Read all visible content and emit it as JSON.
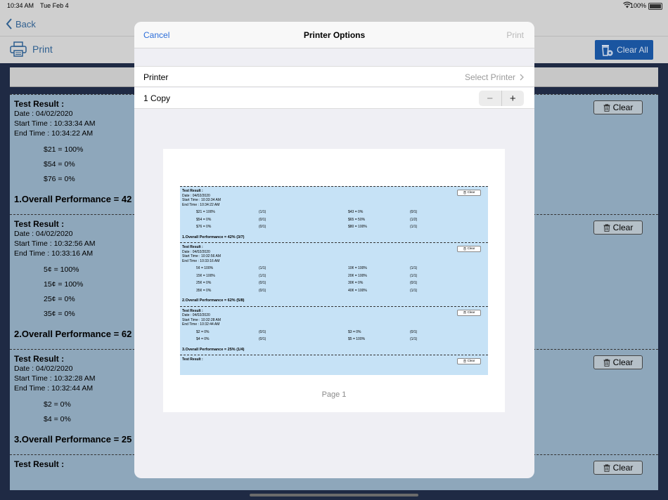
{
  "status_bar": {
    "time": "10:34 AM",
    "date": "Tue Feb 4",
    "battery": "100%",
    "battery_level": 1.0
  },
  "nav": {
    "back_label": "Back"
  },
  "toolbar": {
    "print_label": "Print",
    "clear_all_label": "Clear All"
  },
  "clear_label": "Clear",
  "results": [
    {
      "title": "Test Result :",
      "date": "Date : 04/02/2020",
      "start": "Start Time : 10:33:34 AM",
      "end": "End Time   : 10:34:22 AM",
      "values": [
        "$21 = 100%",
        "$54 = 0%",
        "$76 = 0%"
      ],
      "overall": "1.Overall Performance = 42"
    },
    {
      "title": "Test Result :",
      "date": "Date : 04/02/2020",
      "start": "Start Time : 10:32:56 AM",
      "end": "End Time   : 10:33:16 AM",
      "values": [
        "5¢ = 100%",
        "15¢ = 100%",
        "25¢ = 0%",
        "35¢ = 0%"
      ],
      "overall": "2.Overall Performance = 62"
    },
    {
      "title": "Test Result :",
      "date": "Date : 04/02/2020",
      "start": "Start Time : 10:32:28 AM",
      "end": "End Time   : 10:32:44 AM",
      "values": [
        "$2 = 0%",
        "$4 = 0%"
      ],
      "overall": "3.Overall Performance = 25"
    },
    {
      "title": "Test Result :",
      "date": "",
      "start": "",
      "end": "",
      "values": [],
      "overall": ""
    }
  ],
  "modal": {
    "cancel": "Cancel",
    "title": "Printer Options",
    "print": "Print",
    "printer_label": "Printer",
    "printer_value": "Select Printer",
    "copies_label": "1 Copy",
    "minus": "−",
    "plus": "+",
    "page_label": "Page 1"
  },
  "preview": [
    {
      "title": "Test Result :",
      "date": "Date : 04/02/2020",
      "start": "Start Time : 10:33:34 AM",
      "end": "End Time   : 10:34:22 AM",
      "rows": [
        [
          "$21 = 100%",
          "(1/1)",
          "$43 = 0%",
          "(0/1)"
        ],
        [
          "$54 = 0%",
          "(0/1)",
          "$65 = 50%",
          "(1/2)"
        ],
        [
          "$76 = 0%",
          "(0/1)",
          "$80 = 100%",
          "(1/1)"
        ]
      ],
      "overall": "1.Overall Performance = 42% (3/7)"
    },
    {
      "title": "Test Result :",
      "date": "Date : 04/02/2020",
      "start": "Start Time : 10:32:56 AM",
      "end": "End Time   : 10:33:16 AM",
      "rows": [
        [
          "5¢ = 100%",
          "(1/1)",
          "10¢ = 100%",
          "(1/1)"
        ],
        [
          "15¢ = 100%",
          "(1/1)",
          "20¢ = 100%",
          "(1/1)"
        ],
        [
          "25¢ = 0%",
          "(0/1)",
          "30¢ = 0%",
          "(0/1)"
        ],
        [
          "35¢ = 0%",
          "(0/1)",
          "40¢ = 100%",
          "(1/1)"
        ]
      ],
      "overall": "2.Overall Performance = 62% (5/8)"
    },
    {
      "title": "Test Result :",
      "date": "Date : 04/02/2020",
      "start": "Start Time : 10:32:28 AM",
      "end": "End Time   : 10:32:44 AM",
      "rows": [
        [
          "$2 = 0%",
          "(0/1)",
          "$3 = 0%",
          "(0/1)"
        ],
        [
          "$4 = 0%",
          "(0/1)",
          "$5 = 100%",
          "(1/1)"
        ]
      ],
      "overall": "3.Overall Performance = 25% (1/4)"
    },
    {
      "title": "Test Result :",
      "date": "",
      "start": "",
      "end": "",
      "rows": [],
      "overall": ""
    }
  ]
}
